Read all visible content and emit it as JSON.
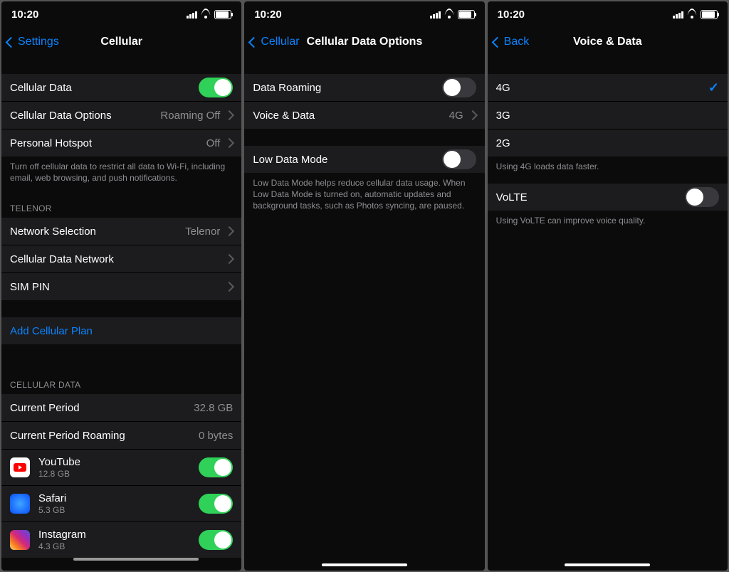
{
  "status_time": "10:20",
  "phone1": {
    "back": "Settings",
    "title": "Cellular",
    "cellular_data": "Cellular Data",
    "cellular_data_options": "Cellular Data Options",
    "cellular_data_options_val": "Roaming Off",
    "personal_hotspot": "Personal Hotspot",
    "personal_hotspot_val": "Off",
    "footer1": "Turn off cellular data to restrict all data to Wi-Fi, including email, web browsing, and push notifications.",
    "carrier_header": "TELENOR",
    "network_selection": "Network Selection",
    "network_selection_val": "Telenor",
    "cellular_data_network": "Cellular Data Network",
    "sim_pin": "SIM PIN",
    "add_plan": "Add Cellular Plan",
    "data_header": "CELLULAR DATA",
    "current_period": "Current Period",
    "current_period_val": "32.8 GB",
    "current_period_roaming": "Current Period Roaming",
    "current_period_roaming_val": "0 bytes",
    "apps": [
      {
        "name": "YouTube",
        "size": "12.8 GB"
      },
      {
        "name": "Safari",
        "size": "5.3 GB"
      },
      {
        "name": "Instagram",
        "size": "4.3 GB"
      }
    ]
  },
  "phone2": {
    "back": "Cellular",
    "title": "Cellular Data Options",
    "data_roaming": "Data Roaming",
    "voice_data": "Voice & Data",
    "voice_data_val": "4G",
    "low_data": "Low Data Mode",
    "footer1": "Low Data Mode helps reduce cellular data usage. When Low Data Mode is turned on, automatic updates and background tasks, such as Photos syncing, are paused."
  },
  "phone3": {
    "back": "Back",
    "title": "Voice & Data",
    "opt4g": "4G",
    "opt3g": "3G",
    "opt2g": "2G",
    "footer1": "Using 4G loads data faster.",
    "volte": "VoLTE",
    "footer2": "Using VoLTE can improve voice quality."
  }
}
